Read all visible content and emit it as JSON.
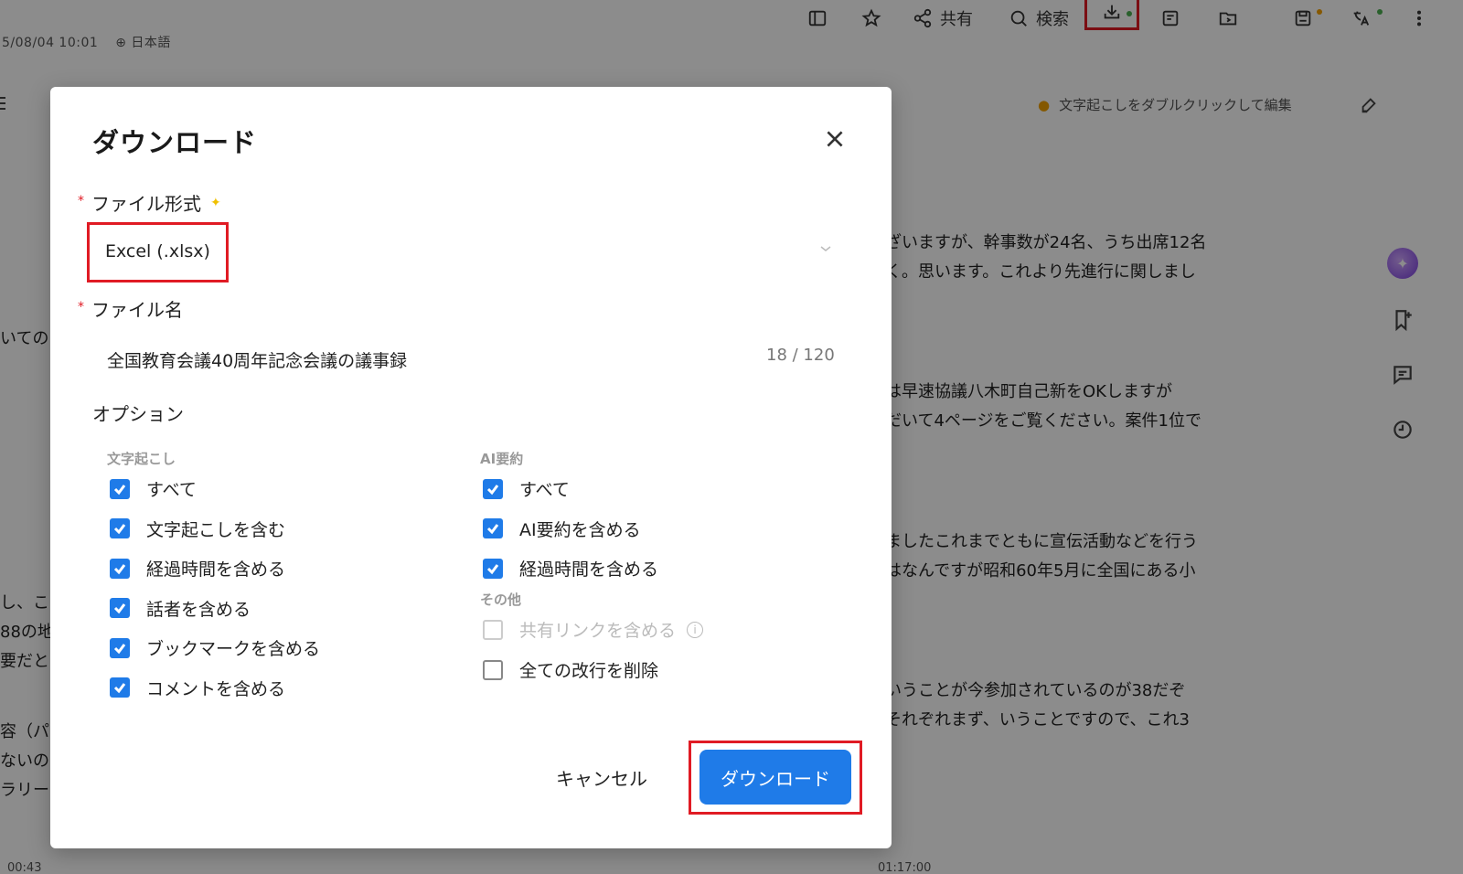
{
  "background": {
    "meta_text": "5/08/04 10:01",
    "language": "日本語",
    "toolbar": {
      "share_label": "共有",
      "search_label": "検索"
    },
    "edit_hint": "文字起こしをダブルクリックして編集",
    "transcript_lines": [
      "ざいますが、幹事数が24名、うち出席12名",
      "く。思います。これより先進行に関しまし",
      "は早速協議八木町自己新をOKしますが",
      "だいて4ページをご覧ください。案件1位で",
      "ましたこれまでともに宣伝活動などを行う",
      "はなんですが昭和60年5月に全国にある小",
      "いうことが今参加されているのが38だぞ",
      "それぞれまず、いうことですので、これ3"
    ],
    "left_fragments": [
      "いての",
      "し、こ",
      "88の地",
      "要だと",
      "容（パ",
      "ないの",
      "ラリー"
    ],
    "time_left": "00:43",
    "time_right": "01:17:00"
  },
  "dialog": {
    "title": "ダウンロード",
    "file_format_label": "ファイル形式",
    "file_format_value": "Excel (.xlsx)",
    "file_name_label": "ファイル名",
    "file_name_value": "全国教育会議40周年記念会議の議事録",
    "file_name_counter": "18 / 120",
    "options_label": "オプション",
    "transcript_section": "文字起こし",
    "ai_section": "AI要約",
    "other_section": "その他",
    "transcript_options": [
      {
        "label": "すべて",
        "checked": true
      },
      {
        "label": "文字起こしを含む",
        "checked": true
      },
      {
        "label": "経過時間を含める",
        "checked": true
      },
      {
        "label": "話者を含める",
        "checked": true
      },
      {
        "label": "ブックマークを含める",
        "checked": true
      },
      {
        "label": "コメントを含める",
        "checked": true
      }
    ],
    "ai_options": [
      {
        "label": "すべて",
        "checked": true
      },
      {
        "label": "AI要約を含める",
        "checked": true
      },
      {
        "label": "経過時間を含める",
        "checked": true
      }
    ],
    "other_options": [
      {
        "label": "共有リンクを含める",
        "checked": false,
        "disabled": true
      },
      {
        "label": "全ての改行を削除",
        "checked": false,
        "disabled": false
      }
    ],
    "cancel_label": "キャンセル",
    "download_label": "ダウンロード"
  },
  "colors": {
    "accent": "#1f7be8",
    "highlight": "#e01b24"
  }
}
